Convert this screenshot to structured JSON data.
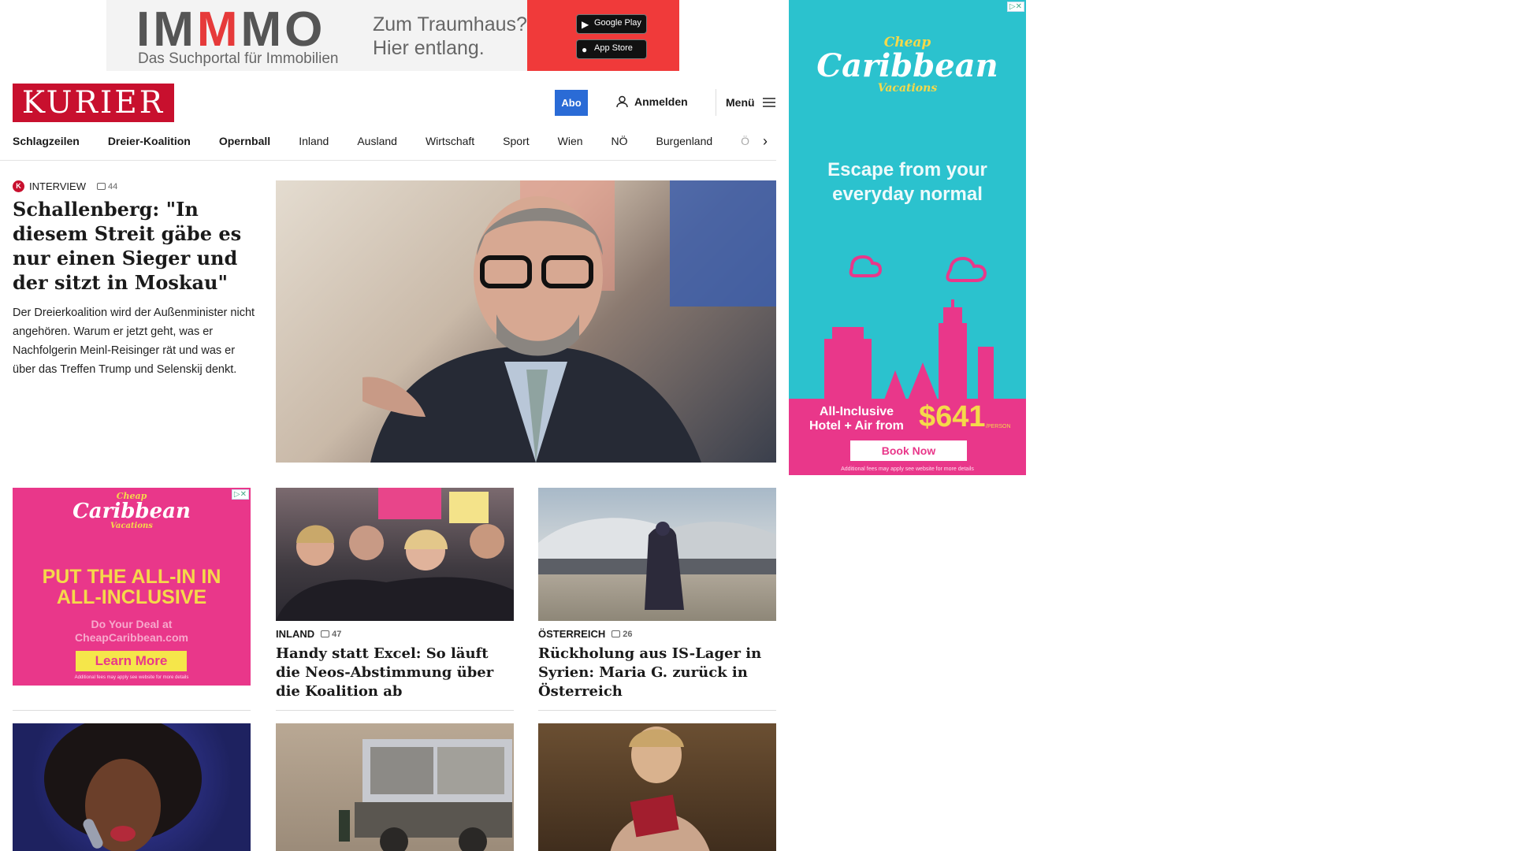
{
  "top_ad": {
    "brand_a": "IM",
    "brand_b": "M",
    "brand_c": "MO",
    "subtitle": "Das Suchportal für Immobilien",
    "tagline_1": "Zum Traumhaus?",
    "tagline_2": "Hier entlang.",
    "google_play": "Google Play",
    "app_store": "App Store"
  },
  "header": {
    "logo": "KURIER",
    "abo": "Abo",
    "login": "Anmelden",
    "menu": "Menü"
  },
  "nav": {
    "items": [
      "Schlagzeilen",
      "Dreier-Koalition",
      "Opernball",
      "Inland",
      "Ausland",
      "Wirtschaft",
      "Sport",
      "Wien",
      "NÖ",
      "Burgenland",
      "Ö"
    ]
  },
  "lead": {
    "kicker": "INTERVIEW",
    "comments": "44",
    "title": "Schallenberg: \"In diesem Streit gäbe es nur einen Sieger und der sitzt in Moskau\"",
    "teaser": "Der Dreierkoalition wird der Außenminister nicht angehören. Warum er jetzt geht, was er Nachfolgerin Meinl-Reisinger rät und was er über das Treffen Trump und Selenskij denkt."
  },
  "side_ad": {
    "logo_1": "Cheap",
    "logo_2": "Caribbean",
    "logo_3": "Vacations",
    "headline_1": "Escape from your",
    "headline_2": "everyday normal",
    "offer_1": "All-Inclusive",
    "offer_2": "Hotel + Air from",
    "price": "$641",
    "per": "/PERSON",
    "cta": "Book Now",
    "fine": "Additional fees may apply see website for more details"
  },
  "mid_ad": {
    "logo_1": "Cheap",
    "logo_2": "Caribbean",
    "logo_3": "Vacations",
    "headline_1": "PUT THE ALL-IN IN",
    "headline_2": "ALL-INCLUSIVE",
    "sub_1": "Do Your Deal at",
    "sub_2": "CheapCaribbean.com",
    "cta": "Learn More",
    "fine": "Additional fees may apply see website for more details"
  },
  "cards": [
    {
      "category": "INLAND",
      "comments": "47",
      "title": "Handy statt Excel: So läuft die Neos-Abstimmung über die Koalition ab"
    },
    {
      "category": "ÖSTERREICH",
      "comments": "26",
      "title": "Rückholung aus IS-Lager in Syrien: Maria G. zurück in Österreich"
    }
  ],
  "colors": {
    "brand_red": "#c8102e",
    "abo_blue": "#2a6bd6",
    "ad_teal": "#2bc2ce",
    "ad_pink": "#e9378a"
  }
}
